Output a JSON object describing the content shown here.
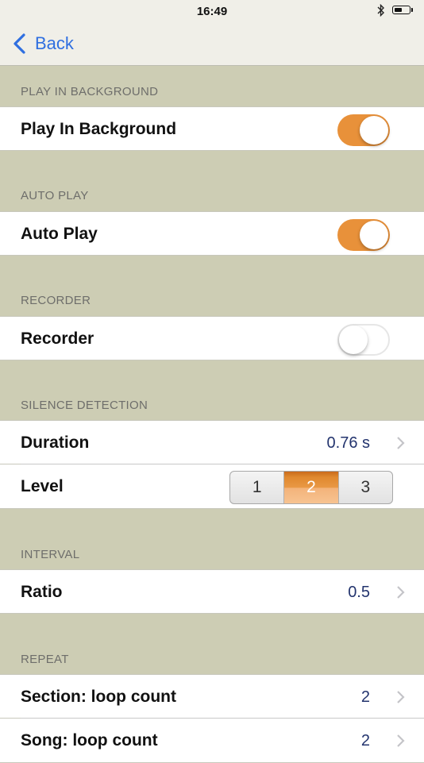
{
  "status": {
    "time": "16:49",
    "battery_level": 0.55
  },
  "nav": {
    "back_label": "Back"
  },
  "sections": {
    "background": {
      "header": "PLAY IN BACKGROUND",
      "label": "Play In Background",
      "enabled": true
    },
    "autoplay": {
      "header": "AUTO PLAY",
      "label": "Auto Play",
      "enabled": true
    },
    "recorder": {
      "header": "RECORDER",
      "label": "Recorder",
      "enabled": false
    },
    "silence": {
      "header": "SILENCE DETECTION",
      "duration_label": "Duration",
      "duration_value": "0.76 s",
      "level_label": "Level",
      "level_options": [
        "1",
        "2",
        "3"
      ],
      "level_selected": "2"
    },
    "interval": {
      "header": "INTERVAL",
      "ratio_label": "Ratio",
      "ratio_value": "0.5"
    },
    "repeat": {
      "header": "REPEAT",
      "section_label": "Section: loop count",
      "section_value": "2",
      "song_label": "Song: loop count",
      "song_value": "2"
    }
  },
  "colors": {
    "accent": "#e8913a",
    "link": "#2f6fe0",
    "value": "#23346e",
    "background": "#cdcdb4"
  },
  "icons": [
    "bluetooth-icon",
    "battery-icon",
    "back-chevron-icon",
    "chevron-right-icon"
  ]
}
